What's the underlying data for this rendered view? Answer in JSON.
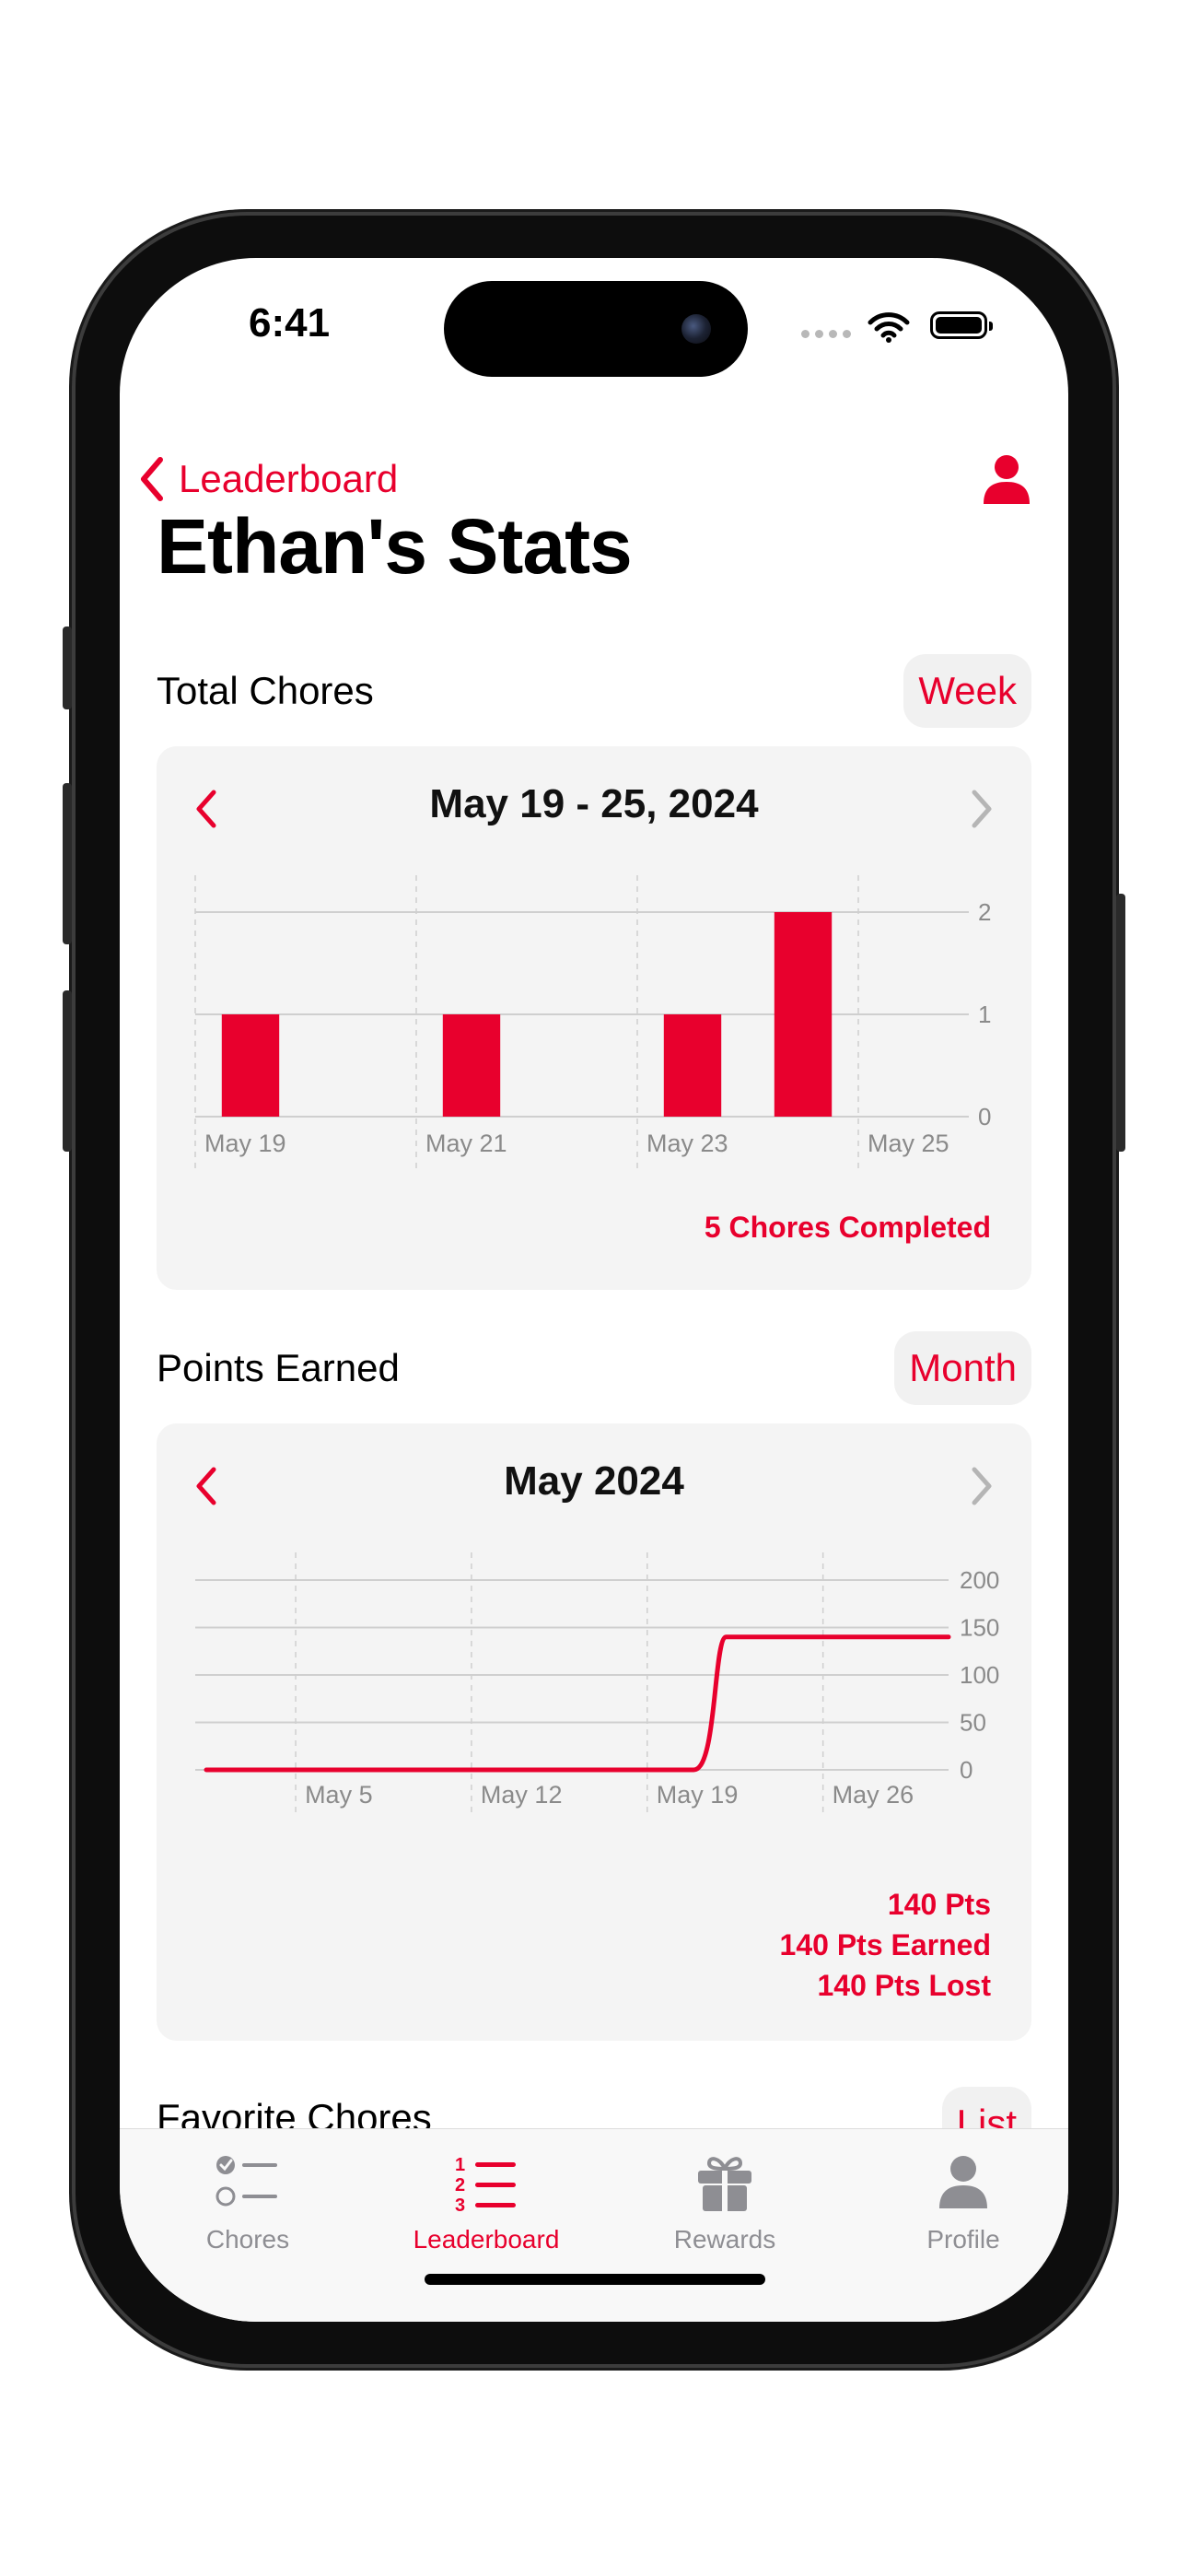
{
  "status_bar": {
    "time": "6:41"
  },
  "nav": {
    "back_label": "Leaderboard"
  },
  "page": {
    "title": "Ethan's Stats"
  },
  "total_chores": {
    "title": "Total Chores",
    "range_button": "Week",
    "period": "May 19 - 25, 2024",
    "summary": "5 Chores Completed",
    "chart_data": {
      "type": "bar",
      "x": [
        "May 19",
        "May 20",
        "May 21",
        "May 22",
        "May 23",
        "May 24",
        "May 25"
      ],
      "values": [
        1,
        0,
        1,
        0,
        1,
        2,
        0
      ],
      "x_tick_labels": [
        "May 19",
        "May 21",
        "May 23",
        "May 25"
      ],
      "y_ticks": [
        0,
        1,
        2
      ],
      "ylim": [
        0,
        2
      ],
      "color": "#e8002d"
    }
  },
  "points_earned": {
    "title": "Points Earned",
    "range_button": "Month",
    "period": "May 2024",
    "summary": [
      "140 Pts",
      "140 Pts Earned",
      "140 Pts Lost"
    ],
    "chart_data": {
      "type": "line",
      "x": [
        "May 1",
        "May 21",
        "May 22",
        "May 31"
      ],
      "y": [
        0,
        0,
        140,
        140
      ],
      "x_tick_labels": [
        "May 5",
        "May 12",
        "May 19",
        "May 26"
      ],
      "y_ticks": [
        0,
        50,
        100,
        150,
        200
      ],
      "ylim": [
        0,
        200
      ],
      "color": "#e8002d"
    }
  },
  "favorite_chores": {
    "title": "Favorite Chores",
    "range_button": "List"
  },
  "tabs": [
    {
      "label": "Chores",
      "icon": "checklist-icon",
      "active": false
    },
    {
      "label": "Leaderboard",
      "icon": "numbered-list-icon",
      "active": true
    },
    {
      "label": "Rewards",
      "icon": "gift-icon",
      "active": false
    },
    {
      "label": "Profile",
      "icon": "person-icon",
      "active": false
    }
  ],
  "colors": {
    "accent": "#e8002d",
    "card_bg": "#f4f4f4",
    "inactive": "#8e8e93"
  }
}
